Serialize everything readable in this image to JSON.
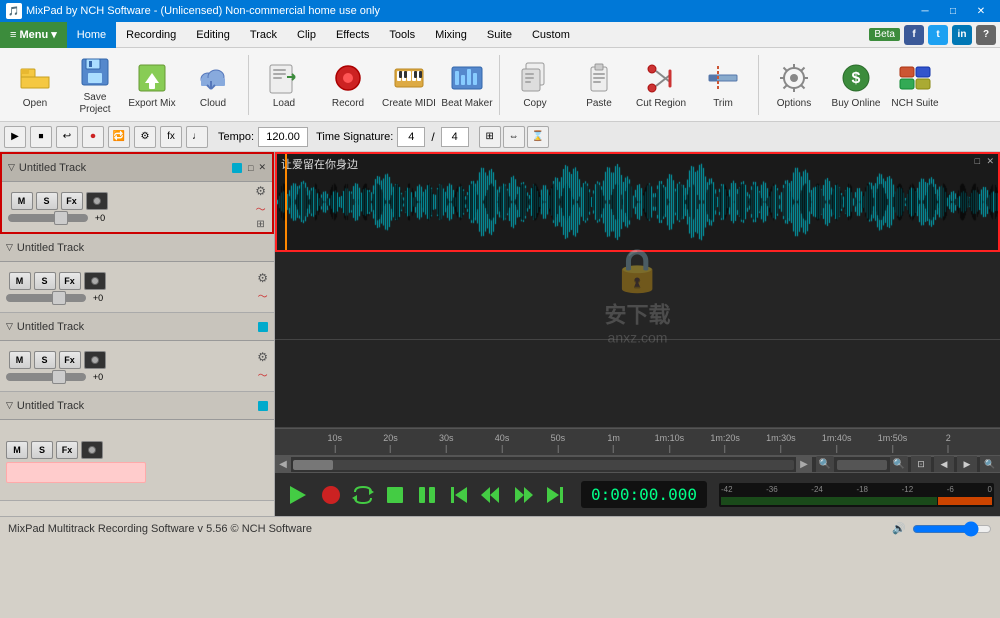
{
  "titleBar": {
    "title": "MixPad by NCH Software - (Unlicensed) Non-commercial home use only",
    "controls": {
      "minimize": "─",
      "maximize": "□",
      "close": "✕"
    }
  },
  "menuBar": {
    "menuBtn": "≡ Menu ▾",
    "items": [
      "Home",
      "Recording",
      "Editing",
      "Track",
      "Clip",
      "Effects",
      "Tools",
      "Mixing",
      "Suite",
      "Custom"
    ],
    "right": {
      "beta": "Beta",
      "socials": [
        "f",
        "t",
        "in",
        "?"
      ]
    }
  },
  "toolbar": {
    "buttons": [
      {
        "id": "open",
        "label": "Open",
        "icon": "folder-open"
      },
      {
        "id": "save-project",
        "label": "Save Project",
        "icon": "save"
      },
      {
        "id": "export-mix",
        "label": "Export Mix",
        "icon": "export"
      },
      {
        "id": "cloud",
        "label": "Cloud",
        "icon": "cloud"
      },
      {
        "id": "load",
        "label": "Load",
        "icon": "load"
      },
      {
        "id": "record",
        "label": "Record",
        "icon": "record"
      },
      {
        "id": "create-midi",
        "label": "Create MIDI",
        "icon": "midi"
      },
      {
        "id": "beat-maker",
        "label": "Beat Maker",
        "icon": "beat"
      },
      {
        "id": "copy",
        "label": "Copy",
        "icon": "copy"
      },
      {
        "id": "paste",
        "label": "Paste",
        "icon": "paste"
      },
      {
        "id": "cut-region",
        "label": "Cut Region",
        "icon": "cut"
      },
      {
        "id": "trim",
        "label": "Trim",
        "icon": "trim"
      },
      {
        "id": "options",
        "label": "Options",
        "icon": "options"
      },
      {
        "id": "buy-online",
        "label": "Buy Online",
        "icon": "buy"
      },
      {
        "id": "nch-suite",
        "label": "NCH Suite",
        "icon": "nch"
      }
    ]
  },
  "controlsBar": {
    "tempoLabel": "Tempo:",
    "tempoValue": "120.00",
    "timeSigLabel": "Time Signature:",
    "timeSigNum": "4",
    "timeSigDen": "4"
  },
  "tracks": [
    {
      "name": "Untitled Track",
      "hasAudio": true,
      "selected": true
    },
    {
      "name": "Untitled Track",
      "hasAudio": false,
      "selected": false
    },
    {
      "name": "Untitled Track",
      "hasAudio": false,
      "selected": false
    },
    {
      "name": "Untitled Track",
      "hasAudio": false,
      "selected": false
    }
  ],
  "trackButtons": {
    "m": "M",
    "s": "S",
    "fx": "Fx"
  },
  "waveformTrack": {
    "title": "让爱留在你身边"
  },
  "ruler": {
    "marks": [
      "10s",
      "20s",
      "30s",
      "40s",
      "50s",
      "1m",
      "1m:10s",
      "1m:20s",
      "1m:30s",
      "1m:40s",
      "1m:50s",
      "2"
    ]
  },
  "playback": {
    "timeDisplay": "0:00:00.000",
    "buttons": {
      "play": "▶",
      "record": "⏺",
      "loop": "↺",
      "stop": "⏹",
      "pause": "⏸",
      "toStart": "⏮",
      "rewind": "⏪",
      "forward": "⏩",
      "toEnd": "⏭"
    }
  },
  "statusBar": {
    "text": "MixPad Multitrack Recording Software v 5.56 © NCH Software",
    "volumeIcon": "🔊"
  }
}
